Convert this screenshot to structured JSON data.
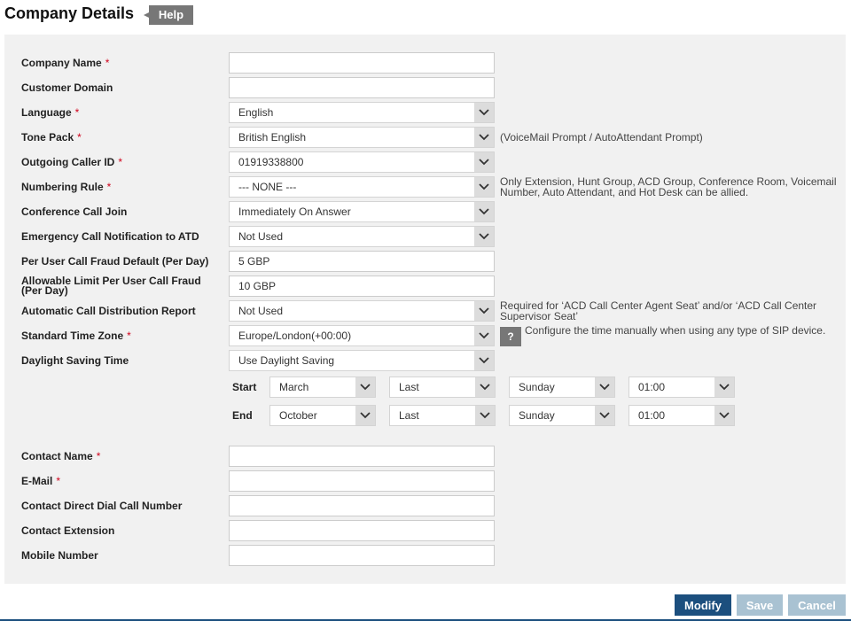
{
  "header": {
    "title": "Company Details",
    "help_label": "Help"
  },
  "required_mark": "*",
  "form": {
    "company_name": {
      "label": "Company Name",
      "value": ""
    },
    "customer_domain": {
      "label": "Customer Domain",
      "value": ""
    },
    "language": {
      "label": "Language",
      "value": "English"
    },
    "tone_pack": {
      "label": "Tone Pack",
      "value": "British English",
      "note": "(VoiceMail Prompt / AutoAttendant Prompt)"
    },
    "outgoing_caller_id": {
      "label": "Outgoing Caller ID",
      "value": "01919338800"
    },
    "numbering_rule": {
      "label": "Numbering Rule",
      "value": "--- NONE ---",
      "note": "Only Extension, Hunt Group, ACD Group, Conference Room, Voicemail Number, Auto Attendant, and Hot Desk can be allied."
    },
    "conference_call_join": {
      "label": "Conference Call Join",
      "value": "Immediately On Answer"
    },
    "emergency_notification": {
      "label": "Emergency Call Notification to ATD",
      "value": "Not Used"
    },
    "fraud_default": {
      "label": "Per User Call Fraud Default (Per Day)",
      "value": "5 GBP"
    },
    "fraud_limit": {
      "label": "Allowable Limit Per User Call Fraud (Per Day)",
      "value": "10 GBP"
    },
    "acd_report": {
      "label": "Automatic Call Distribution Report",
      "value": "Not Used",
      "note": "Required for ‘ACD Call Center Agent Seat’ and/or ‘ACD Call Center Supervisor Seat’"
    },
    "time_zone": {
      "label": "Standard Time Zone",
      "value": "Europe/London(+00:00)",
      "help_icon": "?",
      "note": "Configure the time manually when using any type of SIP device."
    },
    "daylight_saving": {
      "label": "Daylight Saving Time",
      "value": "Use Daylight Saving"
    },
    "dst_start": {
      "label": "Start",
      "month": "March",
      "week": "Last",
      "day": "Sunday",
      "time": "01:00"
    },
    "dst_end": {
      "label": "End",
      "month": "October",
      "week": "Last",
      "day": "Sunday",
      "time": "01:00"
    },
    "contact_name": {
      "label": "Contact Name",
      "value": ""
    },
    "email": {
      "label": "E-Mail",
      "value": ""
    },
    "contact_ddi": {
      "label": "Contact Direct Dial Call Number",
      "value": ""
    },
    "contact_extension": {
      "label": "Contact Extension",
      "value": ""
    },
    "mobile_number": {
      "label": "Mobile Number",
      "value": ""
    }
  },
  "actions": {
    "modify": "Modify",
    "save": "Save",
    "cancel": "Cancel"
  },
  "icons": {
    "dropdown": "chevron-down-icon",
    "help": "question-icon"
  },
  "colors": {
    "primary": "#1c4f7e",
    "disabled": "#a9c2d2",
    "required": "#d0021b",
    "help": "#777777"
  }
}
